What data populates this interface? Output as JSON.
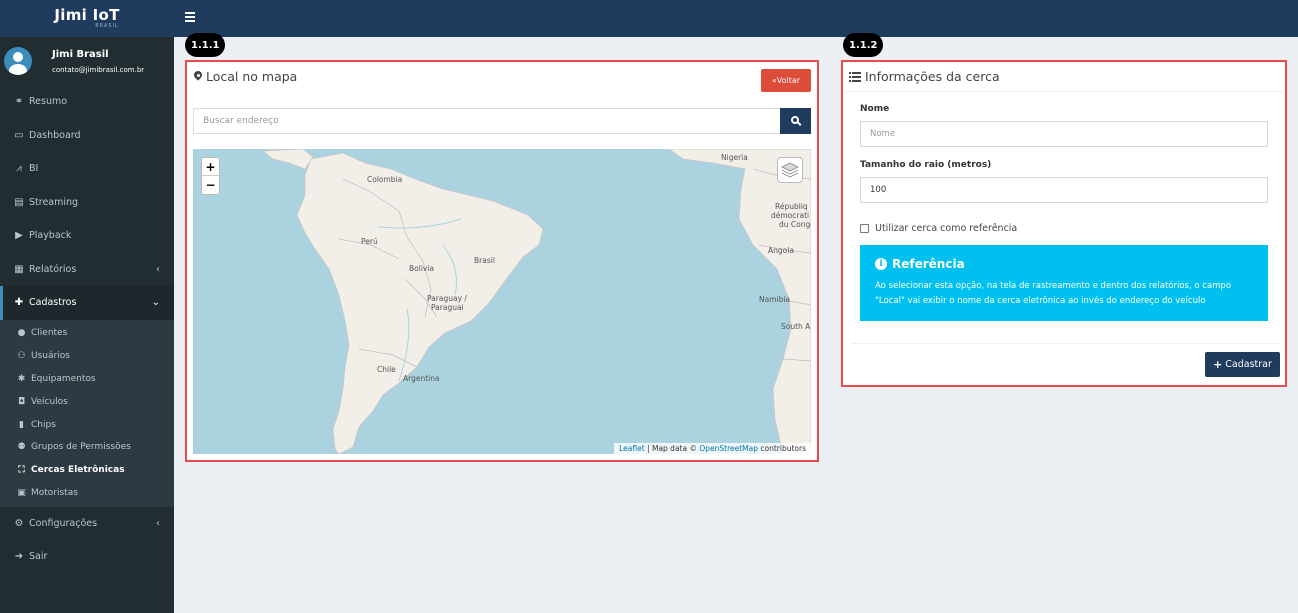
{
  "brand": {
    "name": "Jimi IoT",
    "sub": "BRASIL"
  },
  "user": {
    "name": "Jimi Brasil",
    "email": "contato@jimibrasil.com.br"
  },
  "menu": {
    "resumo": "Resumo",
    "dashboard": "Dashboard",
    "bi": "BI",
    "streaming": "Streaming",
    "playback": "Playback",
    "relatorios": "Relatórios",
    "cadastros": "Cadastros",
    "configuracoes": "Configurações",
    "sair": "Sair"
  },
  "submenu": {
    "clientes": "Clientes",
    "usuarios": "Usuários",
    "equipamentos": "Equipamentos",
    "veiculos": "Veículos",
    "chips": "Chips",
    "grupos": "Grupos de Permissões",
    "cercas": "Cercas Eletrônicas",
    "motoristas": "Motoristas"
  },
  "badges": {
    "left": "1.1.1",
    "right": "1.1.2"
  },
  "map_panel": {
    "title": "Local no mapa",
    "back_button": "Voltar",
    "search_placeholder": "Buscar endereço",
    "zoom_in": "+",
    "zoom_out": "−",
    "attribution": {
      "leaflet": "Leaflet",
      "sep": " | Map data © ",
      "osm": "OpenStreetMap",
      "contributors": " contributors"
    },
    "labels": {
      "colombia": "Colombia",
      "nigeria": "Nigeria",
      "republica": "Républiq",
      "democratica": "démocrati",
      "ducongo": "du Congo",
      "peru": "Perú",
      "brasil": "Brasil",
      "bolivia": "Bolivia",
      "angola": "Angola",
      "paraguay": "Paraguay /",
      "paraguai": "Paraguai",
      "namibia": "Namibia",
      "southa": "South A",
      "chile": "Chile",
      "argentina": "Argentina"
    }
  },
  "form_panel": {
    "title": "Informações da cerca",
    "name_label": "Nome",
    "name_placeholder": "Nome",
    "radius_label": "Tamanho do raio (metros)",
    "radius_value": "100",
    "checkbox_label": "Utilizar cerca como referência",
    "callout_title": "Referência",
    "callout_text": "Ao selecionar esta opção, na tela de rastreamento e dentro dos relatórios, o campo \"Local\" vai exibir o nome da cerca eletrônica ao invés do endereço do veículo",
    "submit": "Cadastrar"
  },
  "colors": {
    "navy": "#1f3c5e",
    "sidebar": "#222d32",
    "red": "#dd4b39",
    "info": "#00c0ef",
    "outline": "#e74c4c"
  }
}
